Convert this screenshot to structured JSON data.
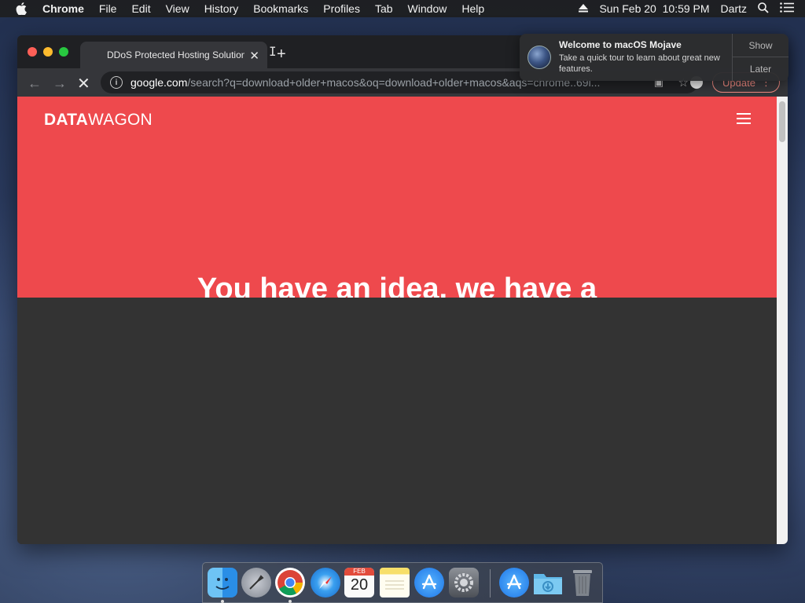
{
  "menubar": {
    "app_name": "Chrome",
    "items": [
      "File",
      "Edit",
      "View",
      "History",
      "Bookmarks",
      "Profiles",
      "Tab",
      "Window",
      "Help"
    ],
    "date_time": "Sun Feb 20  10:59 PM",
    "user": "Dartz"
  },
  "browser": {
    "tab_title": "DDoS Protected Hosting Solutions",
    "url_host": "google.com",
    "url_path": "/search?q=download+older+macos&oq=download+older+macos&aqs=chrome..69i...",
    "update_label": "Update"
  },
  "page": {
    "brand_bold": "DATA",
    "brand_light": "WAGON",
    "headline": "You have an idea, we have a",
    "hero_color": "#ee494d"
  },
  "notification": {
    "title": "Welcome to macOS Mojave",
    "body": "Take a quick tour to learn about great new features.",
    "show_label": "Show",
    "later_label": "Later"
  },
  "dock": {
    "calendar_month": "FEB",
    "calendar_day": "20"
  }
}
